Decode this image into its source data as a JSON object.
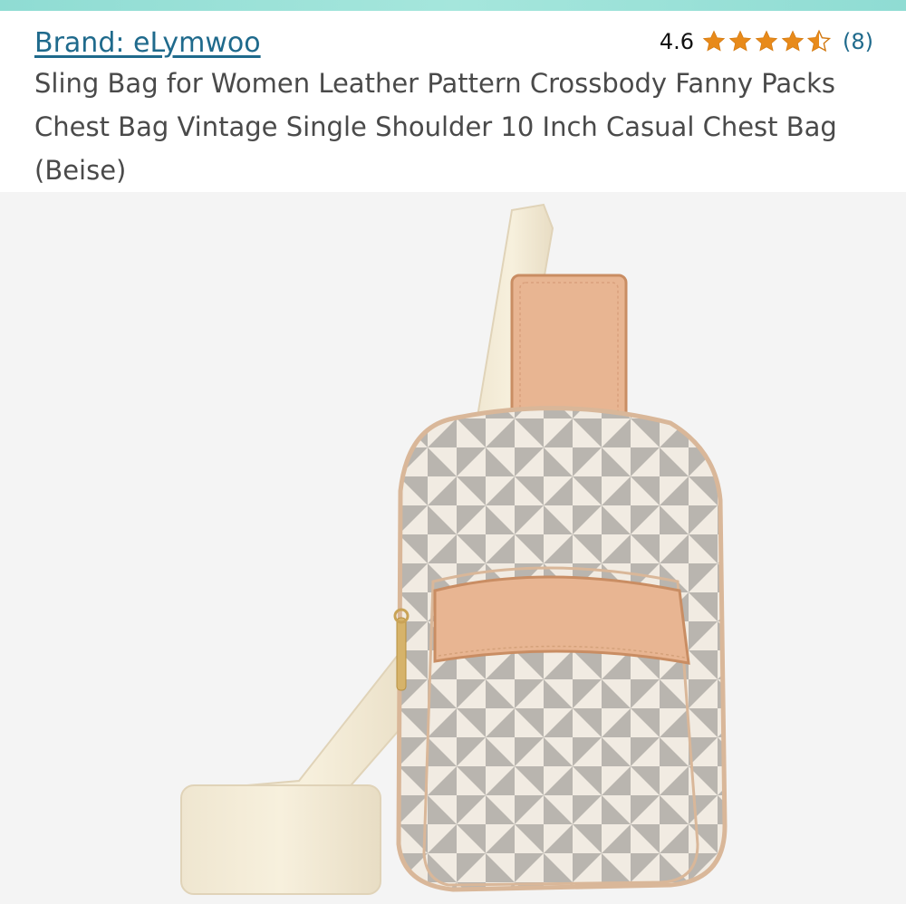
{
  "product": {
    "brand": "Brand: eLymwoo",
    "rating": "4.6",
    "rating_stars": 4.6,
    "review_count": "(8)",
    "title": "Sling Bag for Women Leather Pattern Crossbody Fanny Packs Chest Bag Vintage Single Shoulder 10 Inch Casual Chest Bag (Beise)"
  },
  "colors": {
    "star": "#e88a1a",
    "link": "#1f6a8c",
    "title_text": "#4a4a4a",
    "accent_bar": "#8fdcd3"
  },
  "icons": {
    "rating_star": "star-icon",
    "product_image": "sling-bag-image"
  }
}
